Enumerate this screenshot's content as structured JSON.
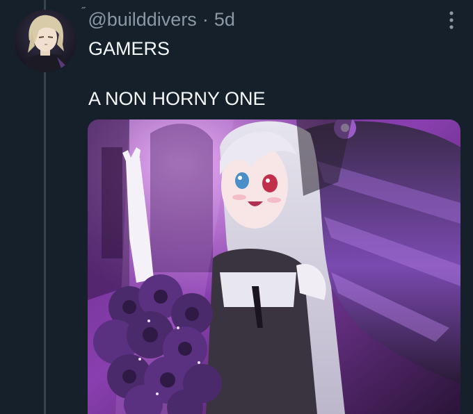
{
  "tweet": {
    "verified_mark": "˝",
    "handle": "@builddivers",
    "separator": "·",
    "age": "5d",
    "text_line1": "GAMERS",
    "text_line2": "A NON HORNY ONE"
  },
  "icons": {
    "more": "more-vertical-icon"
  },
  "colors": {
    "background": "#15202b",
    "text_primary": "#f7f9f9",
    "text_secondary": "#8b98a5",
    "thread_line": "#38444d"
  }
}
